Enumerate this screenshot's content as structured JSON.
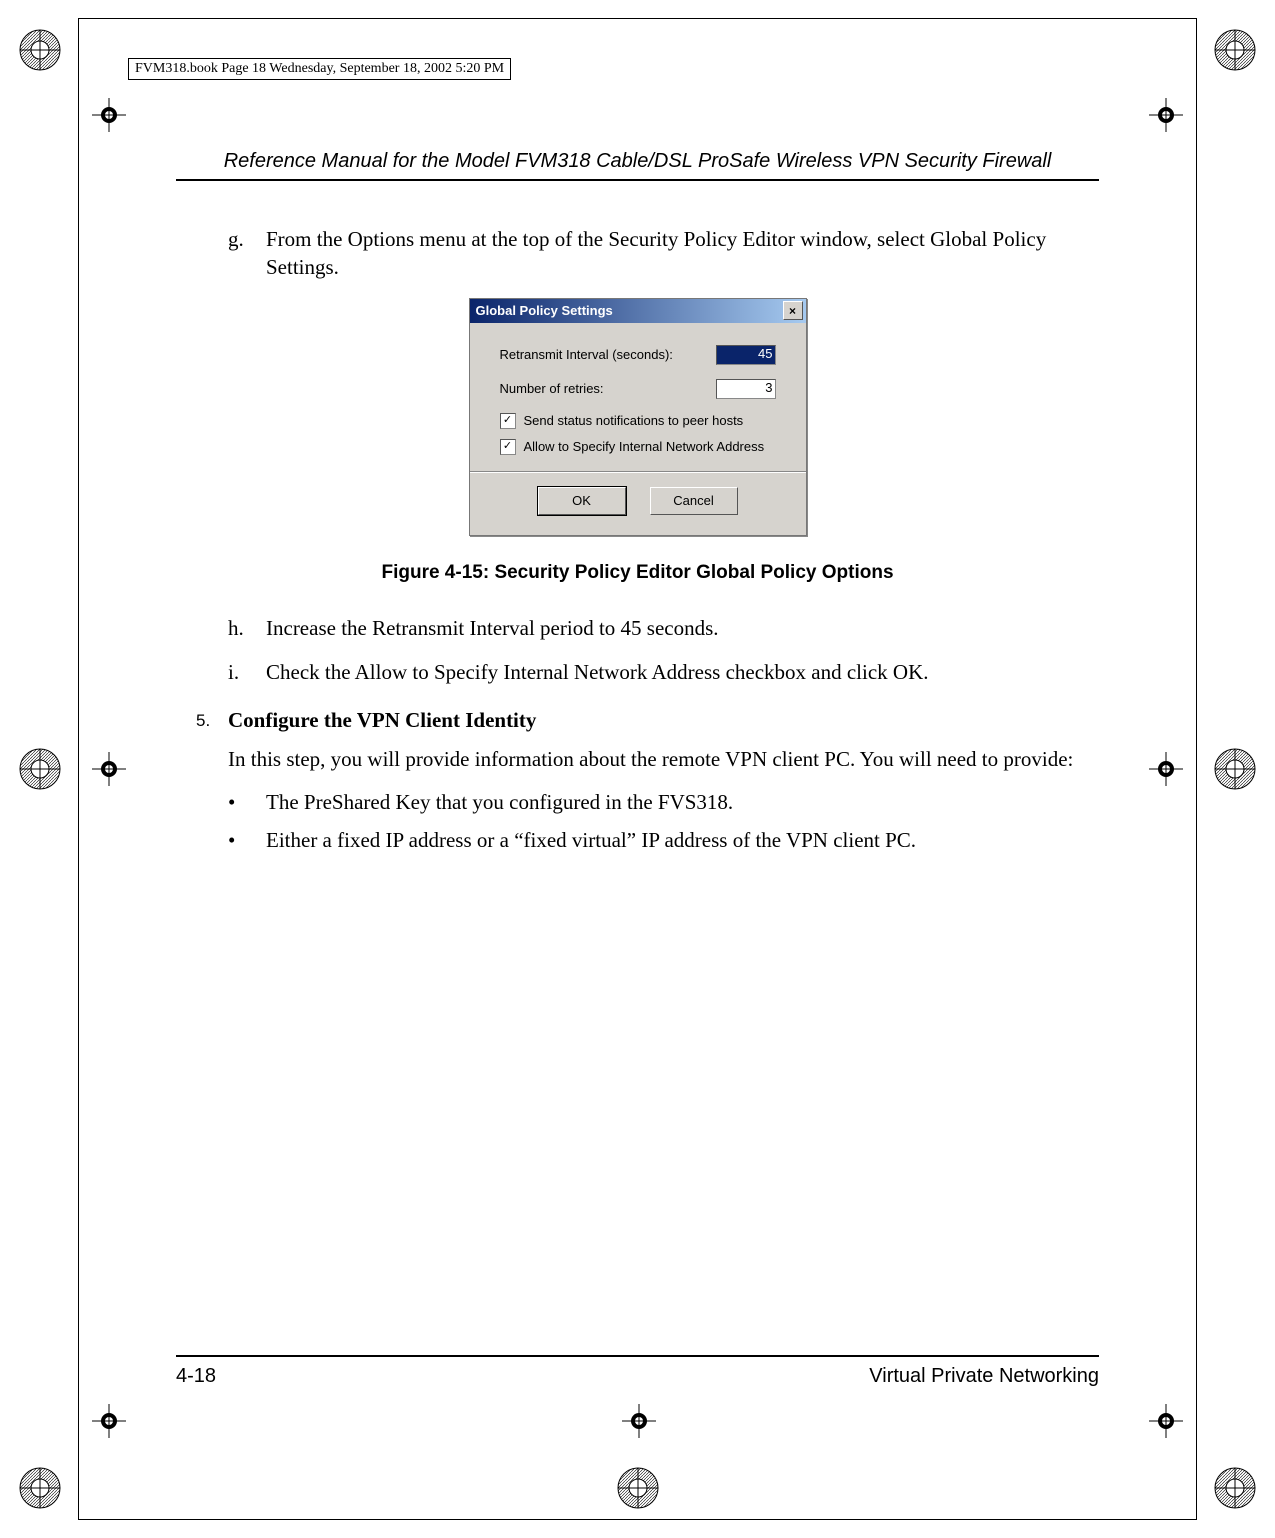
{
  "book_tag": "FVM318.book  Page 18  Wednesday, September 18, 2002  5:20 PM",
  "running_head": "Reference Manual for the Model FVM318 Cable/DSL ProSafe Wireless VPN Security Firewall",
  "steps": {
    "g_marker": "g.",
    "g_text": "From the Options menu at the top of the Security Policy Editor window, select Global Policy Settings.",
    "h_marker": "h.",
    "h_text": "Increase the Retransmit Interval period to 45 seconds.",
    "i_marker": "i.",
    "i_text": "Check the Allow to Specify Internal Network Address checkbox and click OK."
  },
  "dialog": {
    "title": "Global Policy Settings",
    "retransmit_label": "Retransmit Interval (seconds):",
    "retransmit_value": "45",
    "retries_label": "Number of retries:",
    "retries_value": "3",
    "chk1_label": "Send status notifications to peer hosts",
    "chk2_label": "Allow to Specify Internal Network Address",
    "ok_label": "OK",
    "cancel_label": "Cancel",
    "close_glyph": "×",
    "check_glyph": "✓"
  },
  "figure_caption": "Figure 4-15:  Security Policy Editor Global Policy Options",
  "section5": {
    "marker": "5.",
    "title": "Configure the VPN Client Identity",
    "intro": "In this step, you will provide information about the remote VPN client PC. You will need to provide:",
    "bullets": [
      "The PreShared Key that you configured in the FVS318.",
      "Either a fixed IP address or a “fixed virtual” IP address of the VPN client PC."
    ],
    "bullet_glyph": "•"
  },
  "footer": {
    "page_number": "4-18",
    "chapter": "Virtual Private Networking"
  }
}
